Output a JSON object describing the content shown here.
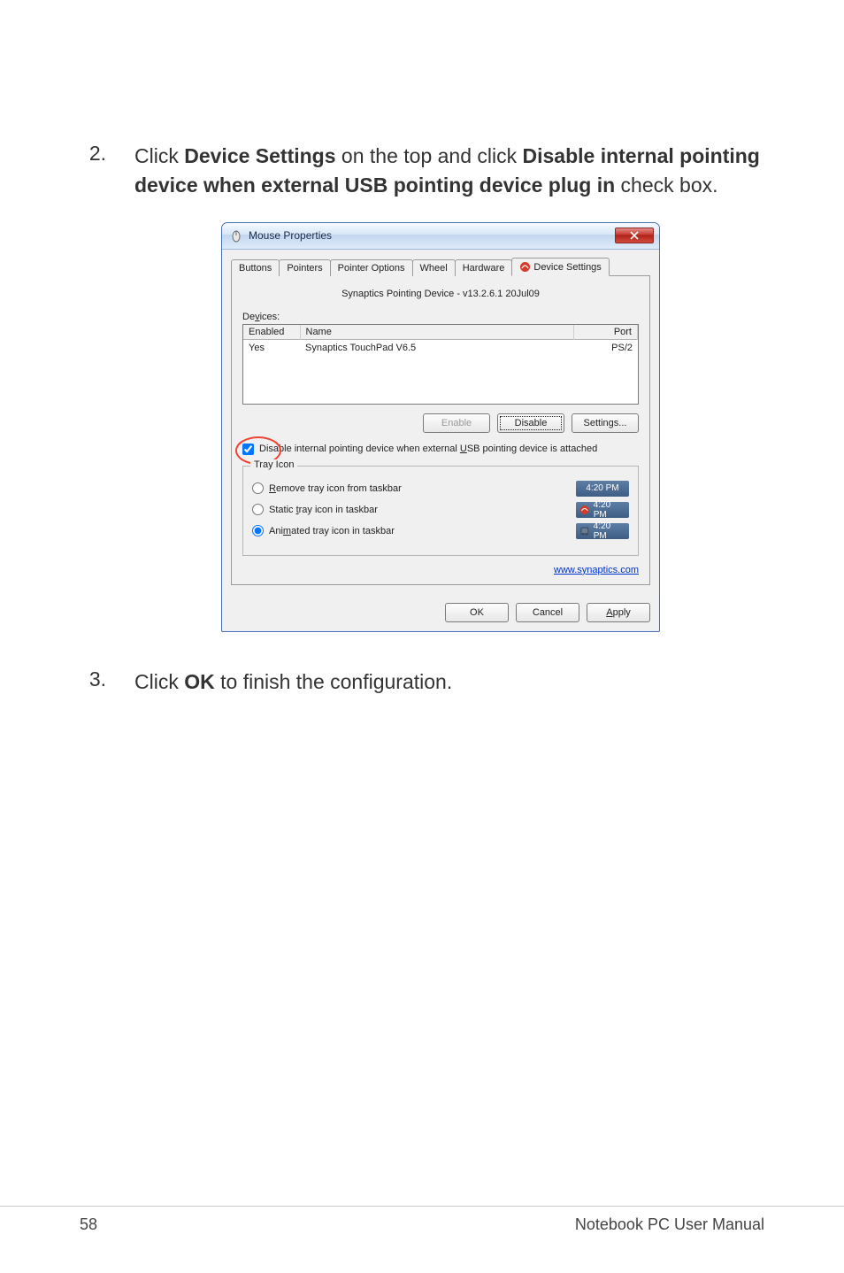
{
  "step2": {
    "num": "2.",
    "text_pre": "Click ",
    "bold1": "Device Settings",
    "text_mid": " on the top and click ",
    "bold2": "Disable internal pointing device when external USB pointing device plug in",
    "text_post": " check box."
  },
  "step3": {
    "num": "3.",
    "text_pre": "Click ",
    "bold": "OK",
    "text_post": " to finish the configuration."
  },
  "dialog": {
    "title": "Mouse Properties",
    "close": "X",
    "tabs": {
      "buttons": "Buttons",
      "pointers": "Pointers",
      "pointer_options": "Pointer Options",
      "wheel": "Wheel",
      "hardware": "Hardware",
      "device_settings": "Device Settings"
    },
    "driver_label": "Synaptics Pointing Device - v13.2.6.1 20Jul09",
    "devices_label_pre": "De",
    "devices_label_u": "v",
    "devices_label_post": "ices:",
    "table": {
      "headers": {
        "enabled": "Enabled",
        "name": "Name",
        "port": "Port"
      },
      "row": {
        "enabled": "Yes",
        "name": "Synaptics TouchPad V6.5",
        "port": "PS/2"
      }
    },
    "buttons": {
      "enable_pre": "E",
      "enable_u": "n",
      "enable_post": "able",
      "disable_u": "D",
      "disable_post": "isable",
      "settings_u": "S",
      "settings_post": "ettings..."
    },
    "checkbox": {
      "pre": "Disable internal pointing device when external ",
      "u": "U",
      "post": "SB pointing device is attached"
    },
    "tray": {
      "legend": "Tray Icon",
      "opt1_u": "R",
      "opt1_post": "emove tray icon from taskbar",
      "opt2_pre": "Static ",
      "opt2_u": "t",
      "opt2_post": "ray icon in taskbar",
      "opt3_pre": "Ani",
      "opt3_u": "m",
      "opt3_post": "ated tray icon in taskbar",
      "time": "4:20 PM"
    },
    "link": "www.synaptics.com",
    "bottom": {
      "ok": "OK",
      "cancel": "Cancel",
      "apply_u": "A",
      "apply_post": "pply"
    }
  },
  "footer": {
    "page": "58",
    "doc": "Notebook PC User Manual"
  }
}
